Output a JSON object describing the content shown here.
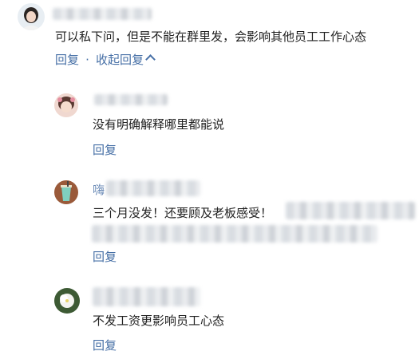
{
  "comment": {
    "text": "可以私下问，但是不能在群里发，会影响其他员工工作心态",
    "reply_label": "回复",
    "separator": "·",
    "collapse_label": "收起回复"
  },
  "replies": [
    {
      "name_fragment": "",
      "text": "没有明确解释哪里都能说",
      "reply_label": "回复"
    },
    {
      "name_fragment": "嗨",
      "text": "三个月没发！还要顾及老板感受！",
      "reply_label": "回复"
    },
    {
      "name_fragment": "",
      "text": "不发工资更影响员工心态",
      "reply_label": "回复"
    }
  ],
  "colors": {
    "link": "#466fa6",
    "text": "#222222",
    "blurred": "#dde0e4"
  }
}
